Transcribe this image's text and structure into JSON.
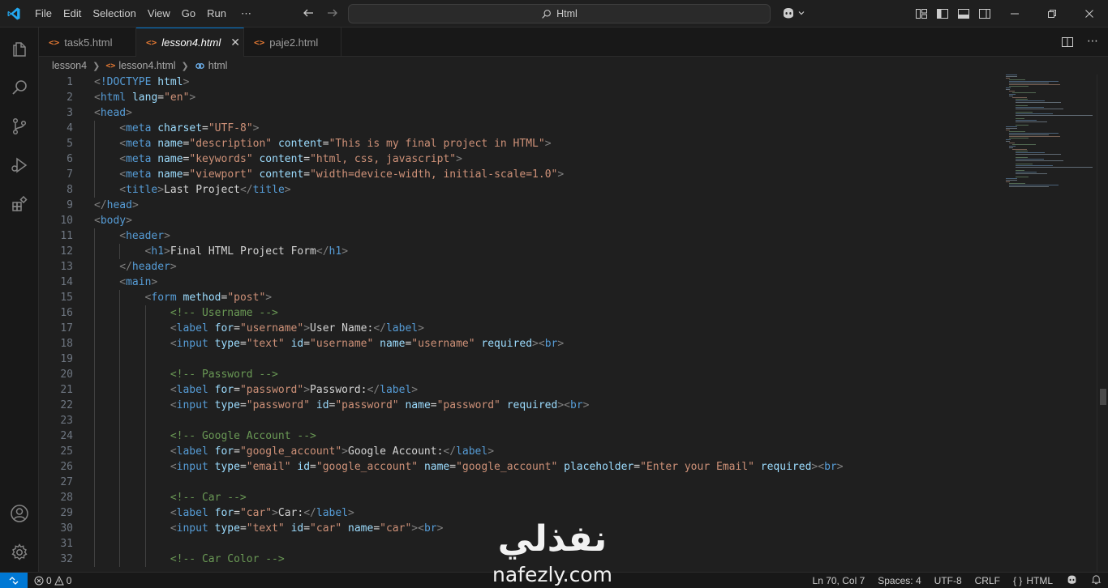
{
  "menu": [
    "File",
    "Edit",
    "Selection",
    "View",
    "Go",
    "Run",
    "⋯"
  ],
  "command_center": "Html",
  "tabs": [
    {
      "label": "task5.html",
      "active": false
    },
    {
      "label": "lesson4.html",
      "active": true
    },
    {
      "label": "paje2.html",
      "active": false
    }
  ],
  "breadcrumb": {
    "folder": "lesson4",
    "file": "lesson4.html",
    "symbol": "html"
  },
  "status": {
    "errors": "0",
    "warnings": "0",
    "position": "Ln 70, Col 7",
    "spaces": "Spaces: 4",
    "encoding": "UTF-8",
    "eol": "CRLF",
    "language": "HTML"
  },
  "watermark": {
    "arabic": "نفذلي",
    "latin": "nafezly.com"
  },
  "code_lines": [
    {
      "n": "1",
      "indent": 0,
      "tokens": [
        [
          "t",
          "<"
        ],
        [
          "k",
          "!DOCTYPE"
        ],
        [
          "x",
          " "
        ],
        [
          "a",
          "html"
        ],
        [
          "t",
          ">"
        ]
      ]
    },
    {
      "n": "2",
      "indent": 0,
      "tokens": [
        [
          "t",
          "<"
        ],
        [
          "k",
          "html"
        ],
        [
          "x",
          " "
        ],
        [
          "a",
          "lang"
        ],
        [
          "x",
          "="
        ],
        [
          "s",
          "\"en\""
        ],
        [
          "t",
          ">"
        ]
      ]
    },
    {
      "n": "3",
      "indent": 0,
      "tokens": [
        [
          "t",
          "<"
        ],
        [
          "k",
          "head"
        ],
        [
          "t",
          ">"
        ]
      ]
    },
    {
      "n": "4",
      "indent": 1,
      "tokens": [
        [
          "t",
          "<"
        ],
        [
          "k",
          "meta"
        ],
        [
          "x",
          " "
        ],
        [
          "a",
          "charset"
        ],
        [
          "x",
          "="
        ],
        [
          "s",
          "\"UTF-8\""
        ],
        [
          "t",
          ">"
        ]
      ]
    },
    {
      "n": "5",
      "indent": 1,
      "tokens": [
        [
          "t",
          "<"
        ],
        [
          "k",
          "meta"
        ],
        [
          "x",
          " "
        ],
        [
          "a",
          "name"
        ],
        [
          "x",
          "="
        ],
        [
          "s",
          "\"description\""
        ],
        [
          "x",
          " "
        ],
        [
          "a",
          "content"
        ],
        [
          "x",
          "="
        ],
        [
          "s",
          "\"This is my final project in HTML\""
        ],
        [
          "t",
          ">"
        ]
      ]
    },
    {
      "n": "6",
      "indent": 1,
      "tokens": [
        [
          "t",
          "<"
        ],
        [
          "k",
          "meta"
        ],
        [
          "x",
          " "
        ],
        [
          "a",
          "name"
        ],
        [
          "x",
          "="
        ],
        [
          "s",
          "\"keywords\""
        ],
        [
          "x",
          " "
        ],
        [
          "a",
          "content"
        ],
        [
          "x",
          "="
        ],
        [
          "s",
          "\"html, css, javascript\""
        ],
        [
          "t",
          ">"
        ]
      ]
    },
    {
      "n": "7",
      "indent": 1,
      "tokens": [
        [
          "t",
          "<"
        ],
        [
          "k",
          "meta"
        ],
        [
          "x",
          " "
        ],
        [
          "a",
          "name"
        ],
        [
          "x",
          "="
        ],
        [
          "s",
          "\"viewport\""
        ],
        [
          "x",
          " "
        ],
        [
          "a",
          "content"
        ],
        [
          "x",
          "="
        ],
        [
          "s",
          "\"width=device-width, initial-scale=1.0\""
        ],
        [
          "t",
          ">"
        ]
      ]
    },
    {
      "n": "8",
      "indent": 1,
      "tokens": [
        [
          "t",
          "<"
        ],
        [
          "k",
          "title"
        ],
        [
          "t",
          ">"
        ],
        [
          "x",
          "Last Project"
        ],
        [
          "t",
          "</"
        ],
        [
          "k",
          "title"
        ],
        [
          "t",
          ">"
        ]
      ]
    },
    {
      "n": "9",
      "indent": 0,
      "tokens": [
        [
          "t",
          "</"
        ],
        [
          "k",
          "head"
        ],
        [
          "t",
          ">"
        ]
      ]
    },
    {
      "n": "10",
      "indent": 0,
      "tokens": [
        [
          "t",
          "<"
        ],
        [
          "k",
          "body"
        ],
        [
          "t",
          ">"
        ]
      ]
    },
    {
      "n": "11",
      "indent": 1,
      "tokens": [
        [
          "t",
          "<"
        ],
        [
          "k",
          "header"
        ],
        [
          "t",
          ">"
        ]
      ]
    },
    {
      "n": "12",
      "indent": 2,
      "tokens": [
        [
          "t",
          "<"
        ],
        [
          "k",
          "h1"
        ],
        [
          "t",
          ">"
        ],
        [
          "x",
          "Final HTML Project Form"
        ],
        [
          "t",
          "</"
        ],
        [
          "k",
          "h1"
        ],
        [
          "t",
          ">"
        ]
      ]
    },
    {
      "n": "13",
      "indent": 1,
      "tokens": [
        [
          "t",
          "</"
        ],
        [
          "k",
          "header"
        ],
        [
          "t",
          ">"
        ]
      ]
    },
    {
      "n": "14",
      "indent": 1,
      "tokens": [
        [
          "t",
          "<"
        ],
        [
          "k",
          "main"
        ],
        [
          "t",
          ">"
        ]
      ]
    },
    {
      "n": "15",
      "indent": 2,
      "tokens": [
        [
          "t",
          "<"
        ],
        [
          "k",
          "form"
        ],
        [
          "x",
          " "
        ],
        [
          "a",
          "method"
        ],
        [
          "x",
          "="
        ],
        [
          "s",
          "\"post\""
        ],
        [
          "t",
          ">"
        ]
      ]
    },
    {
      "n": "16",
      "indent": 3,
      "tokens": [
        [
          "c",
          "<!-- Username -->"
        ]
      ]
    },
    {
      "n": "17",
      "indent": 3,
      "tokens": [
        [
          "t",
          "<"
        ],
        [
          "k",
          "label"
        ],
        [
          "x",
          " "
        ],
        [
          "a",
          "for"
        ],
        [
          "x",
          "="
        ],
        [
          "s",
          "\"username\""
        ],
        [
          "t",
          ">"
        ],
        [
          "x",
          "User Name:"
        ],
        [
          "t",
          "</"
        ],
        [
          "k",
          "label"
        ],
        [
          "t",
          ">"
        ]
      ]
    },
    {
      "n": "18",
      "indent": 3,
      "tokens": [
        [
          "t",
          "<"
        ],
        [
          "k",
          "input"
        ],
        [
          "x",
          " "
        ],
        [
          "a",
          "type"
        ],
        [
          "x",
          "="
        ],
        [
          "s",
          "\"text\""
        ],
        [
          "x",
          " "
        ],
        [
          "a",
          "id"
        ],
        [
          "x",
          "="
        ],
        [
          "s",
          "\"username\""
        ],
        [
          "x",
          " "
        ],
        [
          "a",
          "name"
        ],
        [
          "x",
          "="
        ],
        [
          "s",
          "\"username\""
        ],
        [
          "x",
          " "
        ],
        [
          "a",
          "required"
        ],
        [
          "t",
          "><"
        ],
        [
          "k",
          "br"
        ],
        [
          "t",
          ">"
        ]
      ]
    },
    {
      "n": "19",
      "indent": 3,
      "tokens": []
    },
    {
      "n": "20",
      "indent": 3,
      "tokens": [
        [
          "c",
          "<!-- Password -->"
        ]
      ]
    },
    {
      "n": "21",
      "indent": 3,
      "tokens": [
        [
          "t",
          "<"
        ],
        [
          "k",
          "label"
        ],
        [
          "x",
          " "
        ],
        [
          "a",
          "for"
        ],
        [
          "x",
          "="
        ],
        [
          "s",
          "\"password\""
        ],
        [
          "t",
          ">"
        ],
        [
          "x",
          "Password:"
        ],
        [
          "t",
          "</"
        ],
        [
          "k",
          "label"
        ],
        [
          "t",
          ">"
        ]
      ]
    },
    {
      "n": "22",
      "indent": 3,
      "tokens": [
        [
          "t",
          "<"
        ],
        [
          "k",
          "input"
        ],
        [
          "x",
          " "
        ],
        [
          "a",
          "type"
        ],
        [
          "x",
          "="
        ],
        [
          "s",
          "\"password\""
        ],
        [
          "x",
          " "
        ],
        [
          "a",
          "id"
        ],
        [
          "x",
          "="
        ],
        [
          "s",
          "\"password\""
        ],
        [
          "x",
          " "
        ],
        [
          "a",
          "name"
        ],
        [
          "x",
          "="
        ],
        [
          "s",
          "\"password\""
        ],
        [
          "x",
          " "
        ],
        [
          "a",
          "required"
        ],
        [
          "t",
          "><"
        ],
        [
          "k",
          "br"
        ],
        [
          "t",
          ">"
        ]
      ]
    },
    {
      "n": "23",
      "indent": 3,
      "tokens": []
    },
    {
      "n": "24",
      "indent": 3,
      "tokens": [
        [
          "c",
          "<!-- Google Account -->"
        ]
      ]
    },
    {
      "n": "25",
      "indent": 3,
      "tokens": [
        [
          "t",
          "<"
        ],
        [
          "k",
          "label"
        ],
        [
          "x",
          " "
        ],
        [
          "a",
          "for"
        ],
        [
          "x",
          "="
        ],
        [
          "s",
          "\"google_account\""
        ],
        [
          "t",
          ">"
        ],
        [
          "x",
          "Google Account:"
        ],
        [
          "t",
          "</"
        ],
        [
          "k",
          "label"
        ],
        [
          "t",
          ">"
        ]
      ]
    },
    {
      "n": "26",
      "indent": 3,
      "tokens": [
        [
          "t",
          "<"
        ],
        [
          "k",
          "input"
        ],
        [
          "x",
          " "
        ],
        [
          "a",
          "type"
        ],
        [
          "x",
          "="
        ],
        [
          "s",
          "\"email\""
        ],
        [
          "x",
          " "
        ],
        [
          "a",
          "id"
        ],
        [
          "x",
          "="
        ],
        [
          "s",
          "\"google_account\""
        ],
        [
          "x",
          " "
        ],
        [
          "a",
          "name"
        ],
        [
          "x",
          "="
        ],
        [
          "s",
          "\"google_account\""
        ],
        [
          "x",
          " "
        ],
        [
          "a",
          "placeholder"
        ],
        [
          "x",
          "="
        ],
        [
          "s",
          "\"Enter your Email\""
        ],
        [
          "x",
          " "
        ],
        [
          "a",
          "required"
        ],
        [
          "t",
          "><"
        ],
        [
          "k",
          "br"
        ],
        [
          "t",
          ">"
        ]
      ]
    },
    {
      "n": "27",
      "indent": 3,
      "tokens": []
    },
    {
      "n": "28",
      "indent": 3,
      "tokens": [
        [
          "c",
          "<!-- Car -->"
        ]
      ]
    },
    {
      "n": "29",
      "indent": 3,
      "tokens": [
        [
          "t",
          "<"
        ],
        [
          "k",
          "label"
        ],
        [
          "x",
          " "
        ],
        [
          "a",
          "for"
        ],
        [
          "x",
          "="
        ],
        [
          "s",
          "\"car\""
        ],
        [
          "t",
          ">"
        ],
        [
          "x",
          "Car:"
        ],
        [
          "t",
          "</"
        ],
        [
          "k",
          "label"
        ],
        [
          "t",
          ">"
        ]
      ]
    },
    {
      "n": "30",
      "indent": 3,
      "tokens": [
        [
          "t",
          "<"
        ],
        [
          "k",
          "input"
        ],
        [
          "x",
          " "
        ],
        [
          "a",
          "type"
        ],
        [
          "x",
          "="
        ],
        [
          "s",
          "\"text\""
        ],
        [
          "x",
          " "
        ],
        [
          "a",
          "id"
        ],
        [
          "x",
          "="
        ],
        [
          "s",
          "\"car\""
        ],
        [
          "x",
          " "
        ],
        [
          "a",
          "name"
        ],
        [
          "x",
          "="
        ],
        [
          "s",
          "\"car\""
        ],
        [
          "t",
          "><"
        ],
        [
          "k",
          "br"
        ],
        [
          "t",
          ">"
        ]
      ]
    },
    {
      "n": "31",
      "indent": 3,
      "tokens": []
    },
    {
      "n": "32",
      "indent": 3,
      "tokens": [
        [
          "c",
          "<!-- Car Color -->"
        ]
      ]
    }
  ]
}
